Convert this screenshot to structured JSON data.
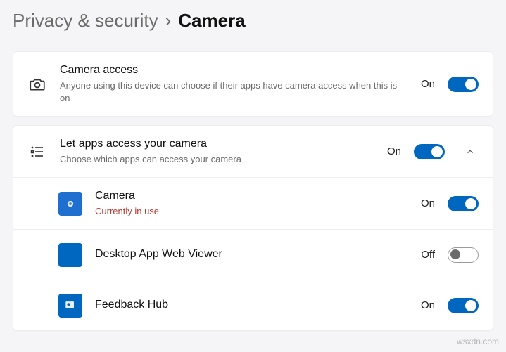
{
  "breadcrumb": {
    "parent": "Privacy & security",
    "current": "Camera"
  },
  "sections": {
    "camera_access": {
      "title": "Camera access",
      "subtitle": "Anyone using this device can choose if their apps have camera access when this is on",
      "status": "On"
    },
    "let_apps": {
      "title": "Let apps access your camera",
      "subtitle": "Choose which apps can access your camera",
      "status": "On"
    }
  },
  "apps": [
    {
      "name": "Camera",
      "sub": "Currently in use",
      "status": "On"
    },
    {
      "name": "Desktop App Web Viewer",
      "sub": "",
      "status": "Off"
    },
    {
      "name": "Feedback Hub",
      "sub": "",
      "status": "On"
    }
  ],
  "watermark": "wsxdn.com"
}
